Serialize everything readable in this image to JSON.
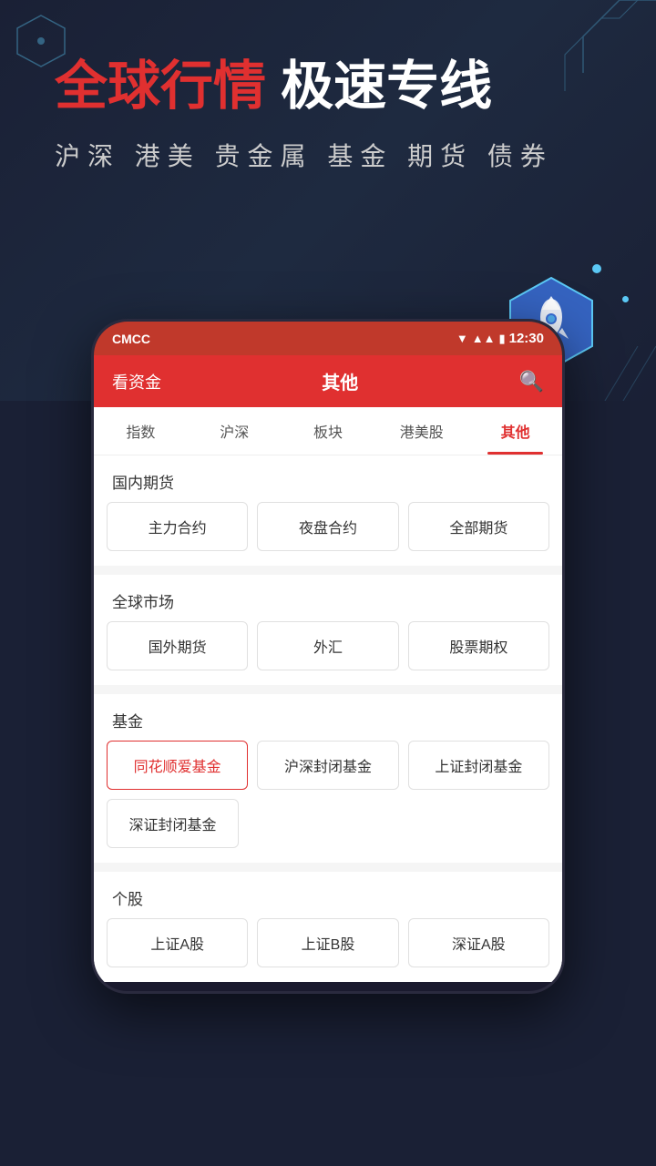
{
  "background": {
    "accent_color": "#e03030",
    "dark_bg": "#1a2035"
  },
  "hero": {
    "title_red": "全球行情",
    "title_white": " 极速专线",
    "subtitle": "沪深 港美 贵金属 基金 期货 债券"
  },
  "status_bar": {
    "carrier": "CMCC",
    "time": "12:30"
  },
  "app_header": {
    "left_label": "看资金",
    "center_label": "其他",
    "search_icon": "🔍"
  },
  "tabs": [
    {
      "label": "指数",
      "active": false
    },
    {
      "label": "沪深",
      "active": false
    },
    {
      "label": "板块",
      "active": false
    },
    {
      "label": "港美股",
      "active": false
    },
    {
      "label": "其他",
      "active": true
    }
  ],
  "sections": [
    {
      "title": "国内期货",
      "buttons": [
        {
          "label": "主力合约",
          "active": false
        },
        {
          "label": "夜盘合约",
          "active": false
        },
        {
          "label": "全部期货",
          "active": false
        }
      ]
    },
    {
      "title": "全球市场",
      "buttons": [
        {
          "label": "国外期货",
          "active": false
        },
        {
          "label": "外汇",
          "active": false
        },
        {
          "label": "股票期权",
          "active": false
        }
      ]
    },
    {
      "title": "基金",
      "buttons": [
        {
          "label": "同花顺爱基金",
          "active": true
        },
        {
          "label": "沪深封闭基金",
          "active": false
        },
        {
          "label": "上证封闭基金",
          "active": false
        },
        {
          "label": "深证封闭基金",
          "active": false
        }
      ]
    },
    {
      "title": "个股",
      "buttons": [
        {
          "label": "上证A股",
          "active": false
        },
        {
          "label": "上证B股",
          "active": false
        },
        {
          "label": "深证A股",
          "active": false
        }
      ]
    }
  ]
}
